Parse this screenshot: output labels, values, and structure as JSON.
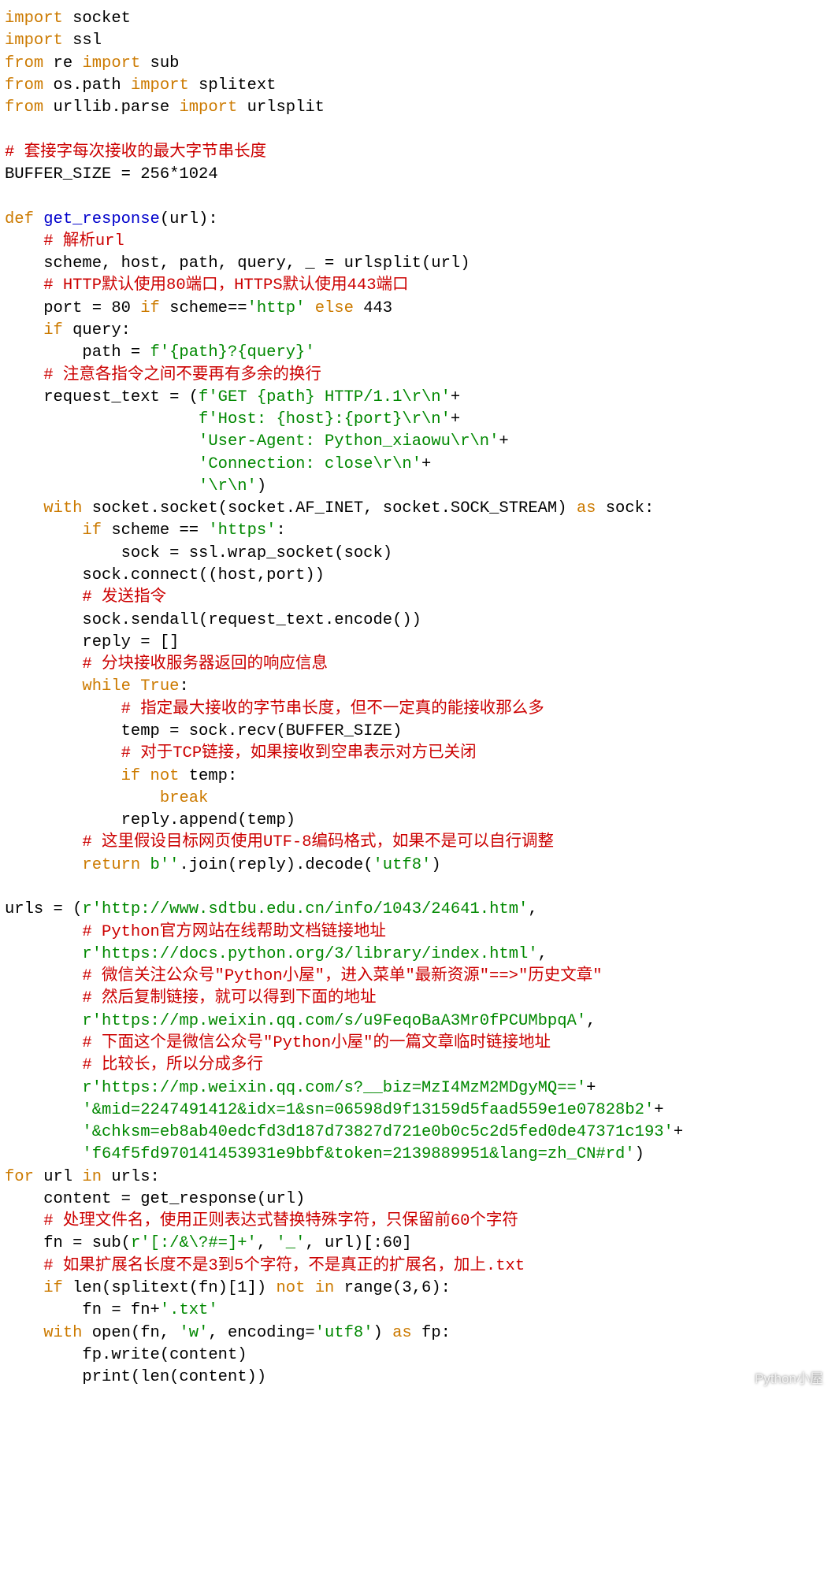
{
  "watermark": "Python小屋",
  "code": {
    "lines": [
      [
        [
          "kw",
          "import"
        ],
        [
          "op",
          " socket"
        ]
      ],
      [
        [
          "kw",
          "import"
        ],
        [
          "op",
          " ssl"
        ]
      ],
      [
        [
          "kw",
          "from"
        ],
        [
          "op",
          " re "
        ],
        [
          "kw",
          "import"
        ],
        [
          "op",
          " sub"
        ]
      ],
      [
        [
          "kw",
          "from"
        ],
        [
          "op",
          " os.path "
        ],
        [
          "kw",
          "import"
        ],
        [
          "op",
          " splitext"
        ]
      ],
      [
        [
          "kw",
          "from"
        ],
        [
          "op",
          " urllib.parse "
        ],
        [
          "kw",
          "import"
        ],
        [
          "op",
          " urlsplit"
        ]
      ],
      [
        [
          "op",
          ""
        ]
      ],
      [
        [
          "cm",
          "# 套接字每次接收的最大字节串长度"
        ]
      ],
      [
        [
          "op",
          "BUFFER_SIZE = 256*1024"
        ]
      ],
      [
        [
          "op",
          ""
        ]
      ],
      [
        [
          "kw",
          "def"
        ],
        [
          "op",
          " "
        ],
        [
          "fn",
          "get_response"
        ],
        [
          "op",
          "(url):"
        ]
      ],
      [
        [
          "op",
          "    "
        ],
        [
          "cm",
          "# 解析url"
        ]
      ],
      [
        [
          "op",
          "    scheme, host, path, query, _ = urlsplit(url)"
        ]
      ],
      [
        [
          "op",
          "    "
        ],
        [
          "cm",
          "# HTTP默认使用80端口，HTTPS默认使用443端口"
        ]
      ],
      [
        [
          "op",
          "    port = 80 "
        ],
        [
          "kw",
          "if"
        ],
        [
          "op",
          " scheme=="
        ],
        [
          "str",
          "'http'"
        ],
        [
          "op",
          " "
        ],
        [
          "kw",
          "else"
        ],
        [
          "op",
          " 443"
        ]
      ],
      [
        [
          "op",
          "    "
        ],
        [
          "kw",
          "if"
        ],
        [
          "op",
          " query:"
        ]
      ],
      [
        [
          "op",
          "        path = "
        ],
        [
          "str",
          "f'{path}?{query}'"
        ]
      ],
      [
        [
          "op",
          "    "
        ],
        [
          "cm",
          "# 注意各指令之间不要再有多余的换行"
        ]
      ],
      [
        [
          "op",
          "    request_text = ("
        ],
        [
          "str",
          "f'GET {path} HTTP/1.1\\r\\n'"
        ],
        [
          "op",
          "+"
        ]
      ],
      [
        [
          "op",
          "                    "
        ],
        [
          "str",
          "f'Host: {host}:{port}\\r\\n'"
        ],
        [
          "op",
          "+"
        ]
      ],
      [
        [
          "op",
          "                    "
        ],
        [
          "str",
          "'User-Agent: Python_xiaowu\\r\\n'"
        ],
        [
          "op",
          "+"
        ]
      ],
      [
        [
          "op",
          "                    "
        ],
        [
          "str",
          "'Connection: close\\r\\n'"
        ],
        [
          "op",
          "+"
        ]
      ],
      [
        [
          "op",
          "                    "
        ],
        [
          "str",
          "'\\r\\n'"
        ],
        [
          "op",
          ")"
        ]
      ],
      [
        [
          "op",
          "    "
        ],
        [
          "kw",
          "with"
        ],
        [
          "op",
          " socket.socket(socket.AF_INET, socket.SOCK_STREAM) "
        ],
        [
          "kw",
          "as"
        ],
        [
          "op",
          " sock:"
        ]
      ],
      [
        [
          "op",
          "        "
        ],
        [
          "kw",
          "if"
        ],
        [
          "op",
          " scheme == "
        ],
        [
          "str",
          "'https'"
        ],
        [
          "op",
          ":"
        ]
      ],
      [
        [
          "op",
          "            sock = ssl.wrap_socket(sock)"
        ]
      ],
      [
        [
          "op",
          "        sock.connect((host,port))"
        ]
      ],
      [
        [
          "op",
          "        "
        ],
        [
          "cm",
          "# 发送指令"
        ]
      ],
      [
        [
          "op",
          "        sock.sendall(request_text.encode())"
        ]
      ],
      [
        [
          "op",
          "        reply = []"
        ]
      ],
      [
        [
          "op",
          "        "
        ],
        [
          "cm",
          "# 分块接收服务器返回的响应信息"
        ]
      ],
      [
        [
          "op",
          "        "
        ],
        [
          "kw",
          "while"
        ],
        [
          "op",
          " "
        ],
        [
          "kw",
          "True"
        ],
        [
          "op",
          ":"
        ]
      ],
      [
        [
          "op",
          "            "
        ],
        [
          "cm",
          "# 指定最大接收的字节串长度，但不一定真的能接收那么多"
        ]
      ],
      [
        [
          "op",
          "            temp = sock.recv(BUFFER_SIZE)"
        ]
      ],
      [
        [
          "op",
          "            "
        ],
        [
          "cm",
          "# 对于TCP链接，如果接收到空串表示对方已关闭"
        ]
      ],
      [
        [
          "op",
          "            "
        ],
        [
          "kw",
          "if"
        ],
        [
          "op",
          " "
        ],
        [
          "kw",
          "not"
        ],
        [
          "op",
          " temp:"
        ]
      ],
      [
        [
          "op",
          "                "
        ],
        [
          "kw",
          "break"
        ]
      ],
      [
        [
          "op",
          "            reply.append(temp)"
        ]
      ],
      [
        [
          "op",
          "        "
        ],
        [
          "cm",
          "# 这里假设目标网页使用UTF-8编码格式，如果不是可以自行调整"
        ]
      ],
      [
        [
          "op",
          "        "
        ],
        [
          "kw",
          "return"
        ],
        [
          "op",
          " "
        ],
        [
          "str",
          "b''"
        ],
        [
          "op",
          ".join(reply).decode("
        ],
        [
          "str",
          "'utf8'"
        ],
        [
          "op",
          ")"
        ]
      ],
      [
        [
          "op",
          ""
        ]
      ],
      [
        [
          "op",
          "urls = ("
        ],
        [
          "str",
          "r'http://www.sdtbu.edu.cn/info/1043/24641.htm'"
        ],
        [
          "op",
          ","
        ]
      ],
      [
        [
          "op",
          "        "
        ],
        [
          "cm",
          "# Python官方网站在线帮助文档链接地址"
        ]
      ],
      [
        [
          "op",
          "        "
        ],
        [
          "str",
          "r'https://docs.python.org/3/library/index.html'"
        ],
        [
          "op",
          ","
        ]
      ],
      [
        [
          "op",
          "        "
        ],
        [
          "cm",
          "# 微信关注公众号\"Python小屋\"，进入菜单\"最新资源\"==>\"历史文章\""
        ]
      ],
      [
        [
          "op",
          "        "
        ],
        [
          "cm",
          "# 然后复制链接，就可以得到下面的地址"
        ]
      ],
      [
        [
          "op",
          "        "
        ],
        [
          "str",
          "r'https://mp.weixin.qq.com/s/u9FeqoBaA3Mr0fPCUMbpqA'"
        ],
        [
          "op",
          ","
        ]
      ],
      [
        [
          "op",
          "        "
        ],
        [
          "cm",
          "# 下面这个是微信公众号\"Python小屋\"的一篇文章临时链接地址"
        ]
      ],
      [
        [
          "op",
          "        "
        ],
        [
          "cm",
          "# 比较长，所以分成多行"
        ]
      ],
      [
        [
          "op",
          "        "
        ],
        [
          "str",
          "r'https://mp.weixin.qq.com/s?__biz=MzI4MzM2MDgyMQ=='"
        ],
        [
          "op",
          "+"
        ]
      ],
      [
        [
          "op",
          "        "
        ],
        [
          "str",
          "'&mid=2247491412&idx=1&sn=06598d9f13159d5faad559e1e07828b2'"
        ],
        [
          "op",
          "+"
        ]
      ],
      [
        [
          "op",
          "        "
        ],
        [
          "str",
          "'&chksm=eb8ab40edcfd3d187d73827d721e0b0c5c2d5fed0de47371c193'"
        ],
        [
          "op",
          "+"
        ]
      ],
      [
        [
          "op",
          "        "
        ],
        [
          "str",
          "'f64f5fd970141453931e9bbf&token=2139889951&lang=zh_CN#rd'"
        ],
        [
          "op",
          ")"
        ]
      ],
      [
        [
          "kw",
          "for"
        ],
        [
          "op",
          " url "
        ],
        [
          "kw",
          "in"
        ],
        [
          "op",
          " urls:"
        ]
      ],
      [
        [
          "op",
          "    content = get_response(url)"
        ]
      ],
      [
        [
          "op",
          "    "
        ],
        [
          "cm",
          "# 处理文件名，使用正则表达式替换特殊字符，只保留前60个字符"
        ]
      ],
      [
        [
          "op",
          "    fn = sub("
        ],
        [
          "str",
          "r'[:/&\\?#=]+'"
        ],
        [
          "op",
          ", "
        ],
        [
          "str",
          "'_'"
        ],
        [
          "op",
          ", url)[:60]"
        ]
      ],
      [
        [
          "op",
          "    "
        ],
        [
          "cm",
          "# 如果扩展名长度不是3到5个字符，不是真正的扩展名，加上.txt"
        ]
      ],
      [
        [
          "op",
          "    "
        ],
        [
          "kw",
          "if"
        ],
        [
          "op",
          " len(splitext(fn)[1]) "
        ],
        [
          "kw",
          "not"
        ],
        [
          "op",
          " "
        ],
        [
          "kw",
          "in"
        ],
        [
          "op",
          " range(3,6):"
        ]
      ],
      [
        [
          "op",
          "        fn = fn+"
        ],
        [
          "str",
          "'.txt'"
        ]
      ],
      [
        [
          "op",
          "    "
        ],
        [
          "kw",
          "with"
        ],
        [
          "op",
          " open(fn, "
        ],
        [
          "str",
          "'w'"
        ],
        [
          "op",
          ", encoding="
        ],
        [
          "str",
          "'utf8'"
        ],
        [
          "op",
          ") "
        ],
        [
          "kw",
          "as"
        ],
        [
          "op",
          " fp:"
        ]
      ],
      [
        [
          "op",
          "        fp.write(content)"
        ]
      ],
      [
        [
          "op",
          "        print(len(content))"
        ]
      ]
    ]
  }
}
